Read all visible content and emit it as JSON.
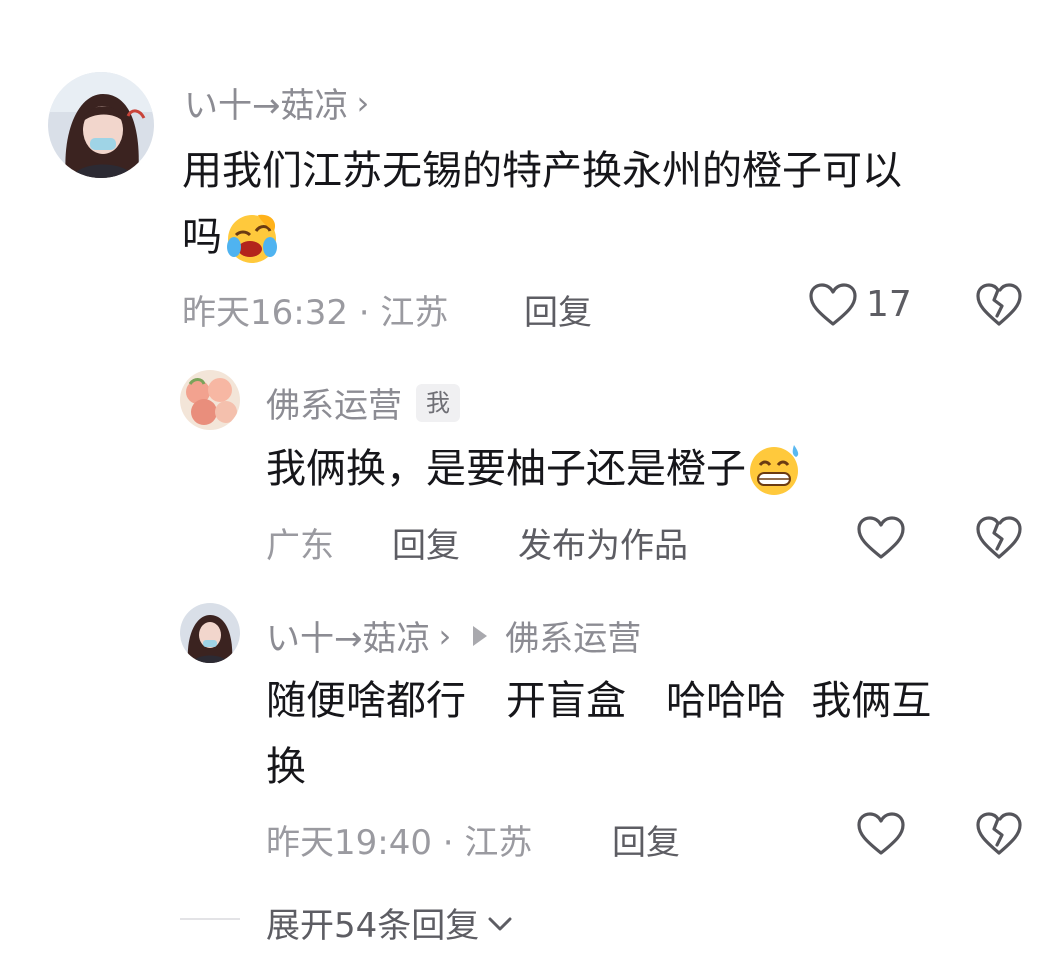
{
  "comments": {
    "main": {
      "username": "い十→菇凉",
      "text_line1": "用我们江苏无锡的特产换永州的橙子可以",
      "text_line2": "吗",
      "emoji_icon": "crying-laughing-emoji",
      "time_location": "昨天16:32 · 江苏",
      "reply_label": "回复",
      "likes": "17"
    },
    "reply1": {
      "username": "佛系运营",
      "badge": "我",
      "text": "我俩换，是要柚子还是橙子",
      "emoji_icon": "grinning-sweat-emoji",
      "location": "广东",
      "reply_label": "回复",
      "publish_label": "发布为作品"
    },
    "reply2": {
      "username": "い十→菇凉",
      "reply_to": "佛系运营",
      "text_line1": "随便啥都行　开盲盒　哈哈哈  我俩互",
      "text_line2": "换",
      "time_location": "昨天19:40 · 江苏",
      "reply_label": "回复"
    }
  },
  "expand": {
    "label": "展开54条回复"
  },
  "colors": {
    "text_primary": "#16161a",
    "text_secondary": "#8c8c93",
    "icon_stroke": "#55555b"
  }
}
